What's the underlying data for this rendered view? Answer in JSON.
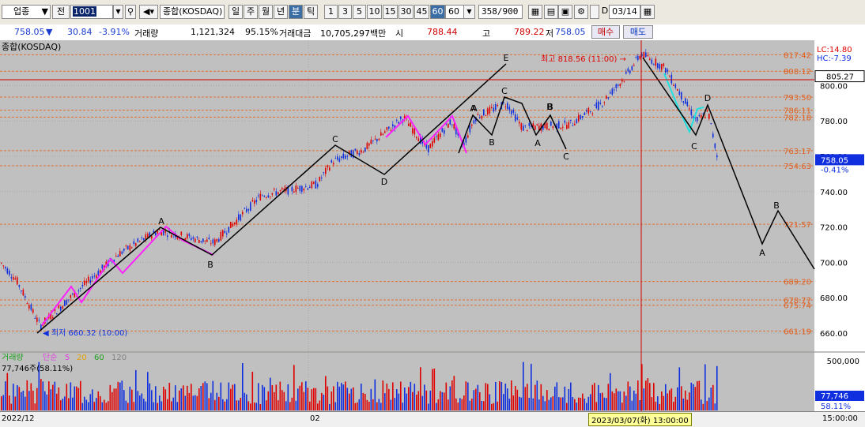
{
  "toolbar": {
    "sector_label": "업종",
    "prev_label": "전",
    "code": "1001",
    "name": "종합(KOSDAQ)",
    "period_buttons": [
      "일",
      "주",
      "월",
      "년",
      "분",
      "틱"
    ],
    "minute_buttons": [
      "1",
      "3",
      "5",
      "10",
      "15",
      "30",
      "45",
      "60"
    ],
    "interval_value": "60",
    "count_value": "358",
    "count_total": "/900",
    "date_value": "03/14"
  },
  "quote": {
    "price": "758.05",
    "change": "30.84",
    "change_pct": "-3.91%",
    "volume_label": "거래량",
    "volume": "1,121,324",
    "volume_pct": "95.15%",
    "value_label": "거래대금",
    "value": "10,705,297백만",
    "open_label": "시",
    "open": "788.44",
    "high_label": "고",
    "high": "789.22",
    "low_label": "저",
    "low": "758.05",
    "buy_label": "매수",
    "sell_label": "매도"
  },
  "chart": {
    "title": "종합(KOSDAQ)",
    "lc_label": "LC:14.80",
    "hc_label": "HC:-7.39",
    "high_note": "최고 818.56 (11:00)",
    "low_note": "최저 660.32 (10:00)",
    "current_price": "805.27",
    "last_price": "758.05",
    "last_pct": "-0.41%",
    "axis_ticks": [
      "800.00",
      "780.00",
      "760.00",
      "740.00",
      "720.00",
      "700.00",
      "680.00",
      "660.00"
    ],
    "hlines": [
      "817.42",
      "808.12",
      "793.50",
      "786.11",
      "782.18",
      "763.17",
      "754.63",
      "721.57",
      "689.20",
      "678.77",
      "675.74",
      "661.19"
    ],
    "wave_labels": [
      "E",
      "C",
      "A",
      "B",
      "A",
      "B",
      "C",
      "A",
      "B",
      "C",
      "D",
      "A",
      "B",
      "C",
      "D",
      "A",
      "B"
    ]
  },
  "volume": {
    "legend_title": "거래량",
    "legend_simple": "단순",
    "legend_ma": [
      "5",
      "20",
      "60",
      "120"
    ],
    "current": "77,746주(58.11%)",
    "axis_top": "500,000",
    "axis_value": "77,746",
    "axis_pct": "58.11%"
  },
  "bottom": {
    "left_date": "2022/12",
    "mid_label": "02",
    "cursor_time": "2023/03/07(화) 13:00:00",
    "right_time": "15:00:00"
  }
}
